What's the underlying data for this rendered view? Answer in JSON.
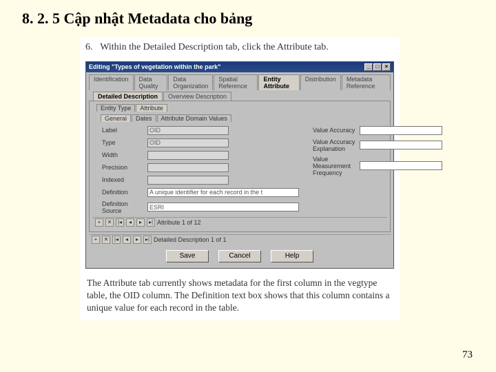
{
  "title": "8. 2. 5 Cập nhật Metadata cho bảng",
  "step": {
    "num": "6.",
    "text": "Within the Detailed Description tab, click the Attribute tab."
  },
  "dialog": {
    "title": "Editing \"Types of vegetation within the park\"",
    "tabs": [
      "Identification",
      "Data Quality",
      "Data Organization",
      "Spatial Reference",
      "Entity Attribute",
      "Distribution",
      "Metadata Reference"
    ],
    "activeTab": "Entity Attribute",
    "subtabs": [
      "Detailed Description",
      "Overview Description"
    ],
    "activeSubtab": "Detailed Description",
    "minitabs": [
      "Entity Type",
      "Attribute"
    ],
    "activeMinitab": "Attribute",
    "subtabs3": [
      "General",
      "Dates",
      "Attribute Domain Values"
    ],
    "activeSubtab3": "General",
    "fields": {
      "label": {
        "lab": "Label",
        "val": "OID"
      },
      "type": {
        "lab": "Type",
        "val": "OID"
      },
      "width": {
        "lab": "Width",
        "val": ""
      },
      "precision": {
        "lab": "Precision",
        "val": ""
      },
      "indexed": {
        "lab": "Indexed",
        "val": ""
      },
      "definition": {
        "lab": "Definition",
        "val": "A unique identifier for each record in the t"
      },
      "defsrc": {
        "lab": "Definition Source",
        "val": "ESRI"
      },
      "valacc": {
        "lab": "Value Accuracy",
        "val": ""
      },
      "valaccex": {
        "lab": "Value Accuracy Explanation",
        "val": ""
      },
      "valmeas": {
        "lab": "Value Measurement Frequency",
        "val": ""
      }
    },
    "nav1": "Attribute 1 of 12",
    "nav2": "Detailed Description 1 of 1",
    "buttons": {
      "save": "Save",
      "cancel": "Cancel",
      "help": "Help"
    }
  },
  "caption": "The Attribute tab currently shows metadata for the first column in the vegtype table, the OID column. The Definition text box shows that this column contains a unique value for each record in the table.",
  "pageNumber": "73"
}
